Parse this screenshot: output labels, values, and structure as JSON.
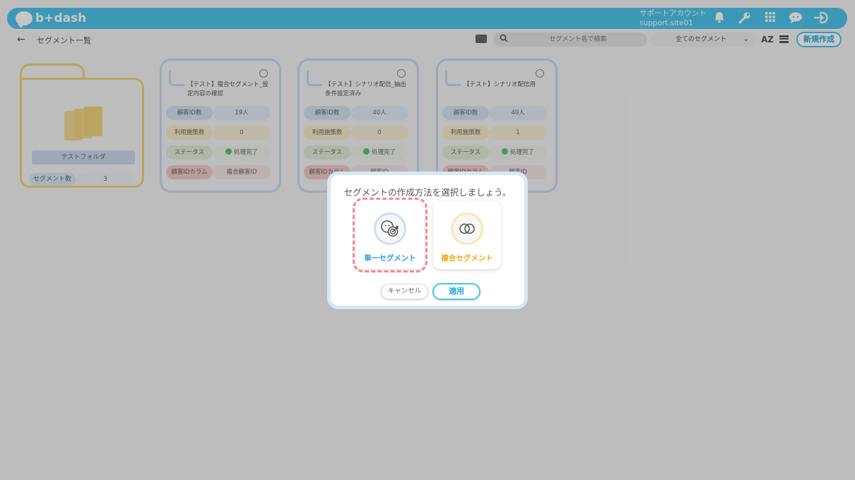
{
  "header": {
    "brand": "b+dash",
    "account_name": "サポートアカウント",
    "account_site": "support.site01"
  },
  "toolbar": {
    "breadcrumb": "セグメント一覧",
    "search_placeholder": "セグメント名で検索",
    "filter_value": "全てのセグメント",
    "sort_label": "AZ",
    "new_button": "新規作成"
  },
  "folder": {
    "name": "テストフォルダ",
    "count_label": "セグメント数",
    "count_value": "3"
  },
  "segments": [
    {
      "title": "【テスト】複合セグメント_設定内容の確認",
      "id_label": "顧客ID数",
      "id_value": "19人",
      "use_label": "利用施策数",
      "use_value": "0",
      "status_label": "ステータス",
      "status_value": "処理完了",
      "col_label": "顧客IDカラム",
      "col_value": "複合顧客ID"
    },
    {
      "title": "【テスト】シナリオ配信_抽出条件設定済み",
      "id_label": "顧客ID数",
      "id_value": "40人",
      "use_label": "利用施策数",
      "use_value": "0",
      "status_label": "ステータス",
      "status_value": "処理完了",
      "col_label": "顧客IDカラム",
      "col_value": "顧客ID"
    },
    {
      "title": "【テスト】シナリオ配信用",
      "id_label": "顧客ID数",
      "id_value": "40人",
      "use_label": "利用施策数",
      "use_value": "1",
      "status_label": "ステータス",
      "status_value": "処理完了",
      "col_label": "顧客IDカラム",
      "col_value": "顧客ID"
    }
  ],
  "modal": {
    "title": "セグメントの作成方法を選択しましょう。",
    "option_single": "単一セグメント",
    "option_compound": "複合セグメント",
    "cancel": "キャンセル",
    "apply": "適用"
  },
  "icons": {
    "bell": "bell-icon",
    "wrench": "wrench-icon",
    "grid": "grid-icon",
    "chat": "chat-icon",
    "logout": "logout-icon"
  },
  "colors": {
    "brand": "#4dc3ea",
    "single_accent": "#2b9ed8",
    "compound_accent": "#eca915",
    "selection_outline": "#f08a94"
  }
}
